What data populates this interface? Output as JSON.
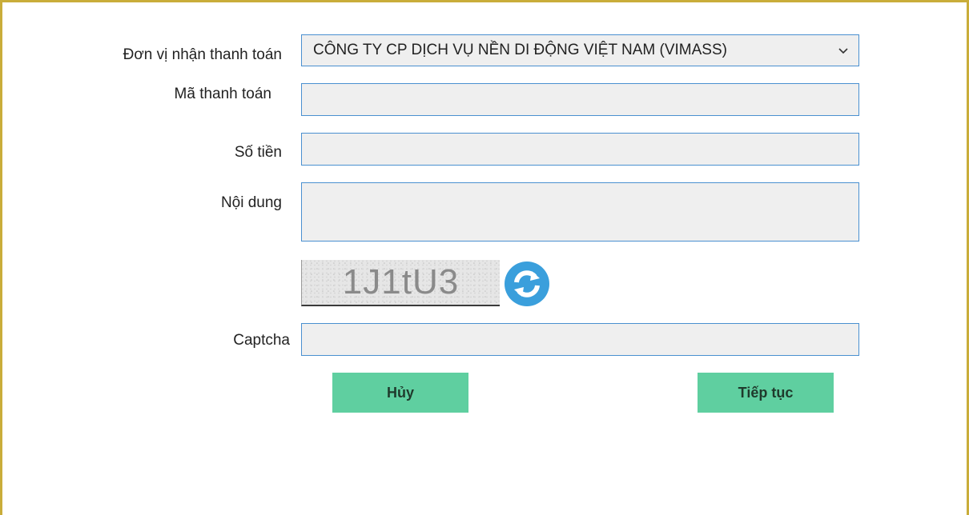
{
  "form": {
    "payee_label": "Đơn vị nhận thanh toán",
    "payee_value": "CÔNG TY CP DỊCH VỤ NỀN DI ĐỘNG VIỆT NAM (VIMASS)",
    "payment_code_label": "Mã thanh toán",
    "payment_code_value": "",
    "amount_label": "Số tiền",
    "amount_value": "",
    "content_label": "Nội dung",
    "content_value": "",
    "captcha_image_text": "1J1tU3",
    "captcha_label": "Captcha",
    "captcha_value": ""
  },
  "actions": {
    "cancel_label": "Hủy",
    "continue_label": "Tiếp tục"
  },
  "colors": {
    "frame_border": "#c9ad3a",
    "field_border": "#4a90d0",
    "field_background": "#efefef",
    "button_background": "#5fcfa0",
    "refresh_icon": "#3a9fdc"
  },
  "icons": {
    "dropdown": "chevron-down-icon",
    "refresh": "refresh-icon"
  }
}
